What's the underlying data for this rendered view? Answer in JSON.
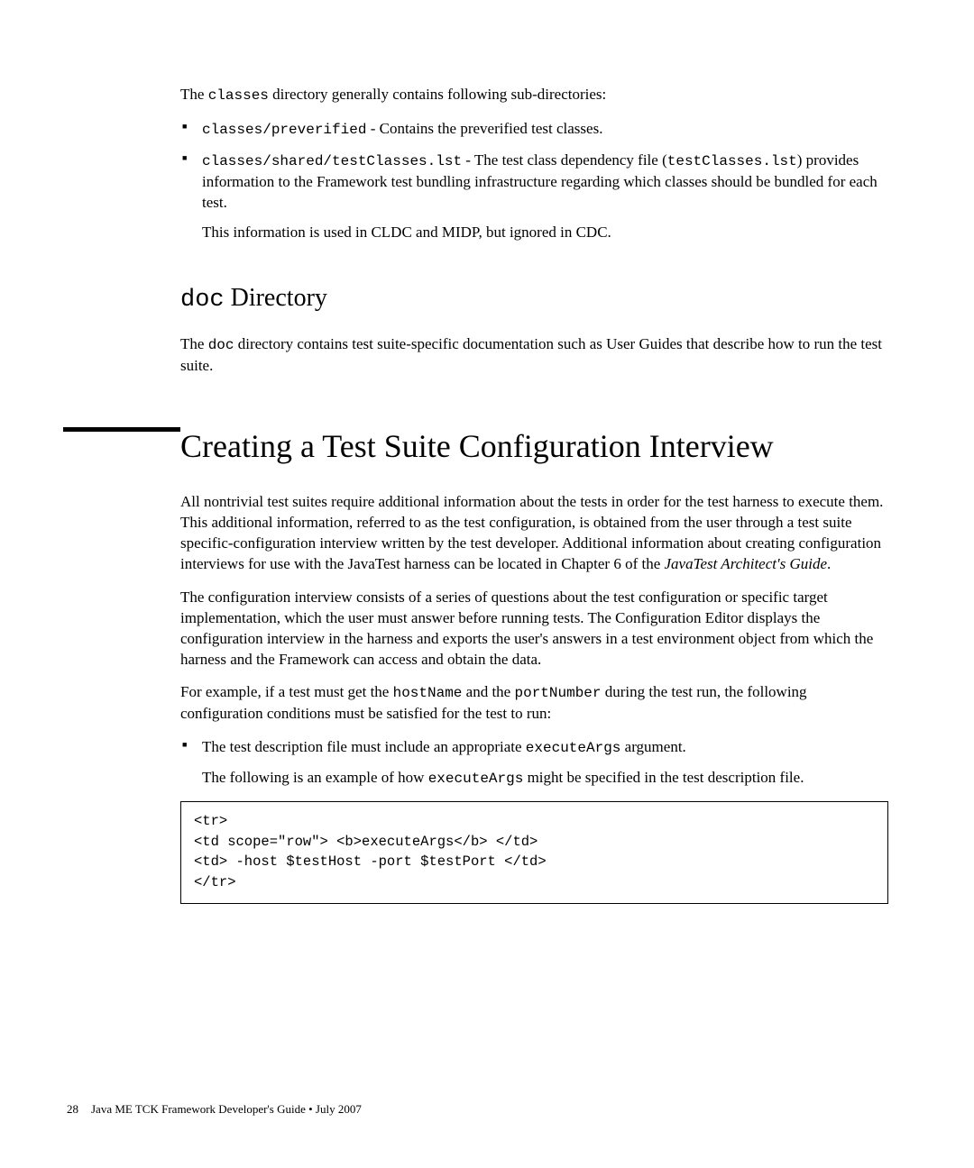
{
  "intro": {
    "p1_a": "The ",
    "p1_code": "classes",
    "p1_b": " directory generally contains following sub-directories:"
  },
  "bullets1": [
    {
      "code": "classes/preverified",
      "tail": " - Contains the preverified test classes."
    },
    {
      "code": "classes/shared/testClasses.lst",
      "tail_a": " - The test class dependency file (",
      "code2": "testClasses.lst",
      "tail_b": ") provides information to the Framework test bundling infrastructure regarding which classes should be bundled for each test.",
      "sub": "This information is used in CLDC and MIDP, but ignored in CDC."
    }
  ],
  "doc_heading_code": "doc",
  "doc_heading_tail": " Directory",
  "doc_para_a": "The ",
  "doc_para_code": "doc",
  "doc_para_b": " directory contains test suite-specific documentation such as User Guides that describe how to run the test suite.",
  "main_heading": "Creating a Test Suite Configuration Interview",
  "main_p1_a": "All nontrivial test suites require additional information about the tests in order for the test harness to execute them. This additional information, referred to as the test configuration, is obtained from the user through a test suite specific-configuration interview written by the test developer. Additional information about creating configuration interviews for use with the JavaTest harness can be located in Chapter 6 of the ",
  "main_p1_i": "JavaTest Architect's Guide",
  "main_p1_b": ".",
  "main_p2": "The configuration interview consists of a series of questions about the test configuration or specific target implementation, which the user must answer before running tests. The Configuration Editor displays the configuration interview in the harness and exports the user's answers in a test environment object from which the harness and the Framework can access and obtain the data.",
  "main_p3_a": "For example, if a test must get the ",
  "main_p3_c1": "hostName",
  "main_p3_b": " and the ",
  "main_p3_c2": "portNumber",
  "main_p3_c": " during the test run, the following configuration conditions must be satisfied for the test to run:",
  "bullets2": [
    {
      "a": "The test description file must include an appropriate ",
      "code": "executeArgs",
      "b": " argument.",
      "sub_a": "The following is an example of how ",
      "sub_code": "executeArgs",
      "sub_b": " might be specified in the test description file."
    }
  ],
  "code_block": "<tr>\n<td scope=\"row\"> <b>executeArgs</b> </td>\n<td> -host $testHost -port $testPort </td>\n</tr>",
  "footer_page": "28",
  "footer_text": "Java ME TCK Framework Developer's Guide  •  July 2007"
}
